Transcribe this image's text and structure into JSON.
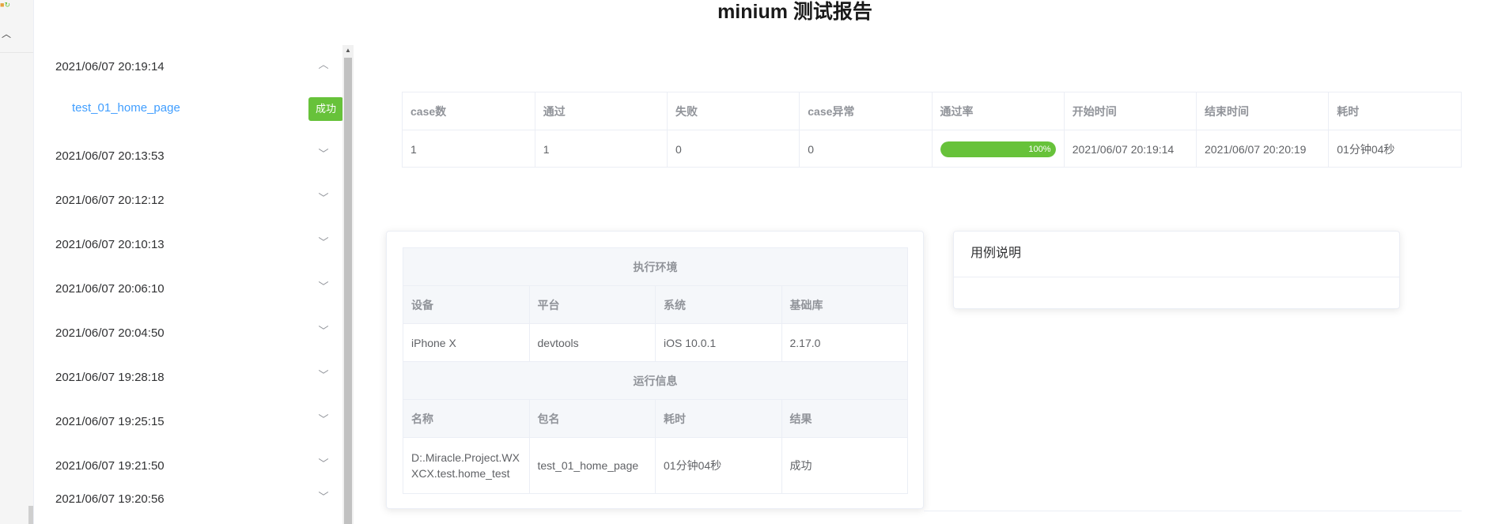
{
  "page": {
    "title": "minium 测试报告"
  },
  "sidebar": {
    "expanded_date": "2021/06/07 20:19:14",
    "case_link": "test_01_home_page",
    "case_status": "成功",
    "dates": [
      "2021/06/07 20:13:53",
      "2021/06/07 20:12:12",
      "2021/06/07 20:10:13",
      "2021/06/07 20:06:10",
      "2021/06/07 20:04:50",
      "2021/06/07 19:28:18",
      "2021/06/07 19:25:15",
      "2021/06/07 19:21:50",
      "2021/06/07 19:20:56"
    ]
  },
  "summary": {
    "headers": [
      "case数",
      "通过",
      "失败",
      "case异常",
      "通过率",
      "开始时间",
      "结束时间",
      "耗时"
    ],
    "row": {
      "cases": "1",
      "passed": "1",
      "failed": "0",
      "errors": "0",
      "pass_rate": 1.0,
      "pass_rate_label": "100%",
      "start_time": "2021/06/07 20:19:14",
      "end_time": "2021/06/07 20:20:19",
      "duration": "01分钟04秒"
    }
  },
  "environment": {
    "title": "执行环境",
    "headers": [
      "设备",
      "平台",
      "系统",
      "基础库"
    ],
    "values": [
      "iPhone X",
      "devtools",
      "iOS 10.0.1",
      "2.17.0"
    ],
    "run_title": "运行信息",
    "run_headers": [
      "名称",
      "包名",
      "耗时",
      "结果"
    ],
    "run_values": [
      "D:.Miracle.Project.WXXCX.test.home_test",
      "test_01_home_page",
      "01分钟04秒",
      "成功"
    ]
  },
  "case_description": {
    "title": "用例说明"
  },
  "colors": {
    "success": "#67c23a",
    "link": "#409eff"
  }
}
